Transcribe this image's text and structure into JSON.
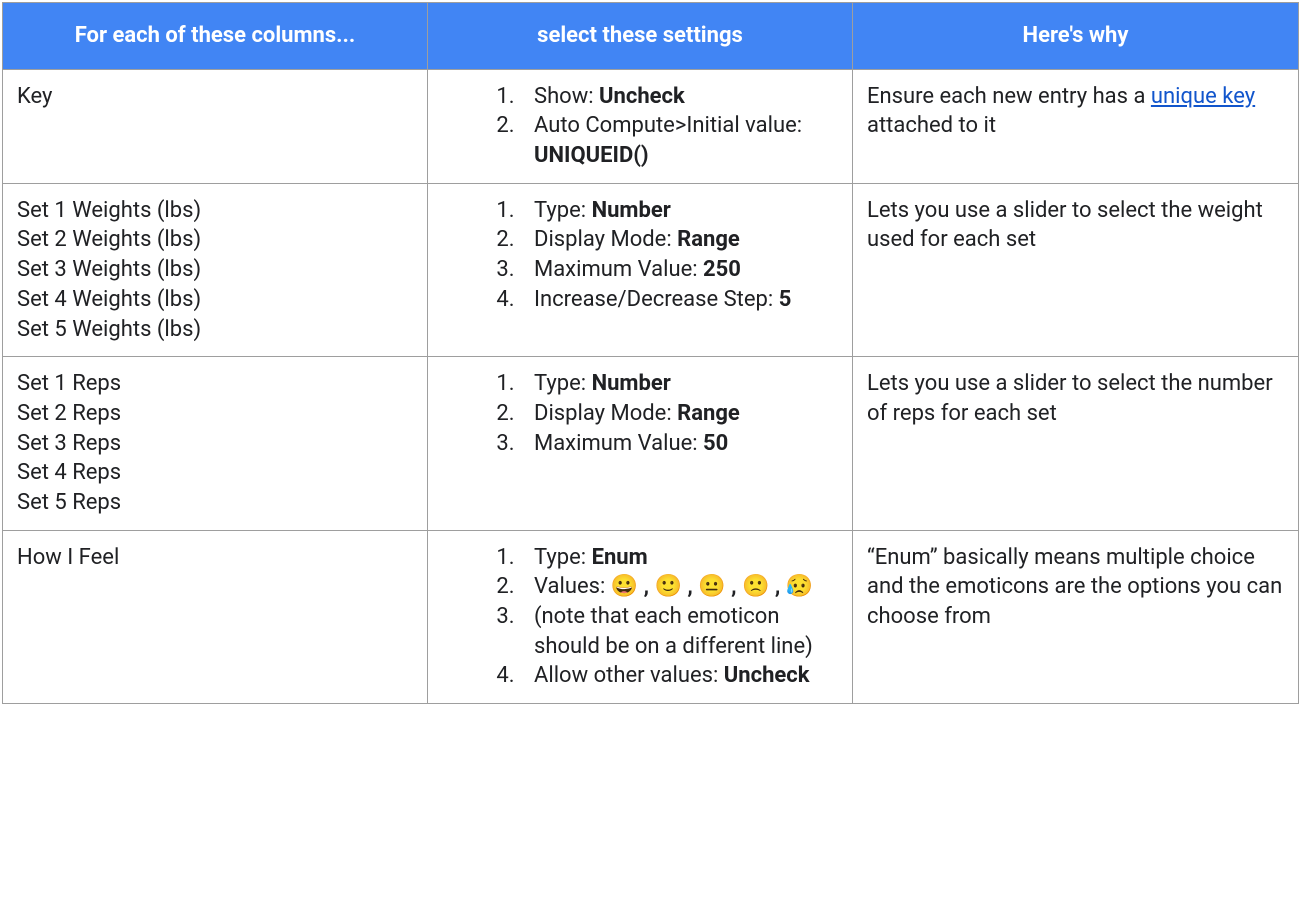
{
  "headers": {
    "col1": "For each of these columns...",
    "col2": "select these settings",
    "col3": "Here's why"
  },
  "rows": [
    {
      "columns": [
        "Key"
      ],
      "settings": [
        {
          "label": "Show: ",
          "value": "Uncheck"
        },
        {
          "label": "Auto Compute>Initial value: ",
          "value": "UNIQUEID()"
        }
      ],
      "why": {
        "pre": "Ensure each new entry has a ",
        "link": "unique key",
        "post": " attached to it"
      }
    },
    {
      "columns": [
        "Set 1 Weights (lbs)",
        "Set 2 Weights (lbs)",
        "Set 3 Weights (lbs)",
        "Set 4 Weights (lbs)",
        "Set 5 Weights (lbs)"
      ],
      "settings": [
        {
          "label": "Type: ",
          "value": "Number"
        },
        {
          "label": "Display Mode: ",
          "value": "Range"
        },
        {
          "label": "Maximum Value: ",
          "value": "250"
        },
        {
          "label": "Increase/Decrease Step: ",
          "value": "5"
        }
      ],
      "why": {
        "pre": "Lets you use a slider to select the weight used for each set",
        "link": "",
        "post": ""
      }
    },
    {
      "columns": [
        "Set 1 Reps",
        "Set 2 Reps",
        "Set 3 Reps",
        "Set 4 Reps",
        "Set 5 Reps"
      ],
      "settings": [
        {
          "label": "Type: ",
          "value": "Number"
        },
        {
          "label": "Display Mode: ",
          "value": "Range"
        },
        {
          "label": "Maximum Value: ",
          "value": "50"
        }
      ],
      "why": {
        "pre": "Lets you use a slider to select the number of reps for each set",
        "link": "",
        "post": ""
      }
    },
    {
      "columns": [
        "How I Feel"
      ],
      "settings": [
        {
          "label": "Type: ",
          "value": "Enum"
        },
        {
          "label": "Values: ",
          "value": "😀 , 🙂 , 😐 , 🙁 , 😥"
        },
        {
          "label": "(note that each emoticon should be on a different line)",
          "value": ""
        },
        {
          "label": "Allow other values: ",
          "value": "Uncheck"
        }
      ],
      "why": {
        "pre": "“Enum” basically means multiple choice and the emoticons are the options you can choose from",
        "link": "",
        "post": ""
      }
    }
  ]
}
